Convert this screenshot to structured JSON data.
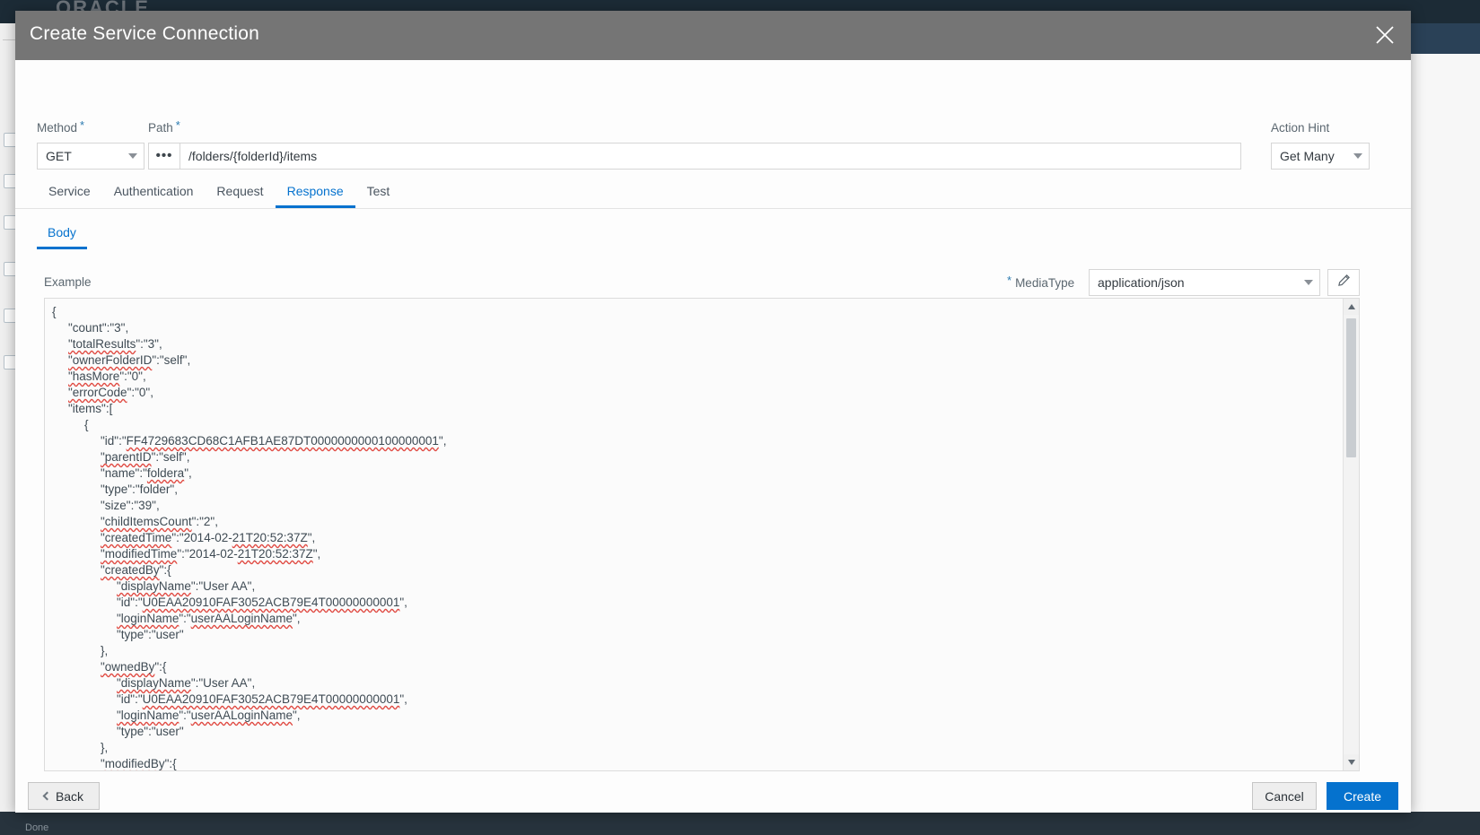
{
  "background": {
    "brand": "ORACLE",
    "status_text": "Done"
  },
  "dialog": {
    "title": "Create Service Connection",
    "close_icon": "close-icon"
  },
  "form": {
    "method": {
      "label": "Method",
      "required": true,
      "value": "GET"
    },
    "path": {
      "label": "Path",
      "required": true,
      "value": "/folders/{folderId}/items",
      "placeholder": "",
      "more_button": "•••"
    },
    "action_hint": {
      "label": "Action Hint",
      "required": false,
      "value": "Get Many"
    }
  },
  "tabs": [
    {
      "label": "Service",
      "active": false
    },
    {
      "label": "Authentication",
      "active": false
    },
    {
      "label": "Request",
      "active": false
    },
    {
      "label": "Response",
      "active": true
    },
    {
      "label": "Test",
      "active": false
    }
  ],
  "subtabs": [
    {
      "label": "Body",
      "active": true
    }
  ],
  "body_section": {
    "example_label": "Example",
    "mediatype_label": "MediaType",
    "mediatype_required": true,
    "mediatype_value": "application/json",
    "edit_icon": "pencil-icon"
  },
  "code": {
    "lines": [
      {
        "indent": 0,
        "text": "{"
      },
      {
        "indent": 1,
        "segments": [
          {
            "t": "\"count\":\"3\","
          }
        ]
      },
      {
        "indent": 1,
        "segments": [
          {
            "t": "\"totalResults",
            "sq": true
          },
          {
            "t": "\":\"3\","
          }
        ]
      },
      {
        "indent": 1,
        "segments": [
          {
            "t": "\"ownerFolderID",
            "sq": true
          },
          {
            "t": "\":\"self\","
          }
        ]
      },
      {
        "indent": 1,
        "segments": [
          {
            "t": "\"hasMore",
            "sq": true
          },
          {
            "t": "\":\"0\","
          }
        ]
      },
      {
        "indent": 1,
        "segments": [
          {
            "t": "\"errorCode",
            "sq": true
          },
          {
            "t": "\":\"0\","
          }
        ]
      },
      {
        "indent": 1,
        "segments": [
          {
            "t": "\"items\":["
          }
        ]
      },
      {
        "indent": 2,
        "segments": [
          {
            "t": "{"
          }
        ]
      },
      {
        "indent": 3,
        "segments": [
          {
            "t": "\"id\":\""
          },
          {
            "t": "FF4729683CD68C1AFB1AE87DT0000000000100000001",
            "sq": true
          },
          {
            "t": "\","
          }
        ]
      },
      {
        "indent": 3,
        "segments": [
          {
            "t": "\"parentID",
            "sq": true
          },
          {
            "t": "\":\"self\","
          }
        ]
      },
      {
        "indent": 3,
        "segments": [
          {
            "t": "\"name\":\""
          },
          {
            "t": "foldera",
            "sq": true
          },
          {
            "t": "\","
          }
        ]
      },
      {
        "indent": 3,
        "segments": [
          {
            "t": "\"type\":\"folder\","
          }
        ]
      },
      {
        "indent": 3,
        "segments": [
          {
            "t": "\"size\":\"39\","
          }
        ]
      },
      {
        "indent": 3,
        "segments": [
          {
            "t": "\"childItemsCount",
            "sq": true
          },
          {
            "t": "\":\"2\","
          }
        ]
      },
      {
        "indent": 3,
        "segments": [
          {
            "t": "\"createdTime",
            "sq": true
          },
          {
            "t": "\":\"2014-02-"
          },
          {
            "t": "21T20:52:37Z",
            "sq": true
          },
          {
            "t": "\","
          }
        ]
      },
      {
        "indent": 3,
        "segments": [
          {
            "t": "\"modifiedTime",
            "sq": true
          },
          {
            "t": "\":\"2014-02-"
          },
          {
            "t": "21T20:52:37Z",
            "sq": true
          },
          {
            "t": "\","
          }
        ]
      },
      {
        "indent": 3,
        "segments": [
          {
            "t": "\"createdBy",
            "sq": true
          },
          {
            "t": "\":{"
          }
        ]
      },
      {
        "indent": 4,
        "segments": [
          {
            "t": "\"displayName",
            "sq": true
          },
          {
            "t": "\":\"User AA\","
          }
        ]
      },
      {
        "indent": 4,
        "segments": [
          {
            "t": "\"id\":\""
          },
          {
            "t": "U0EAA20910FAF3052ACB79E4T00000000001",
            "sq": true
          },
          {
            "t": "\","
          }
        ]
      },
      {
        "indent": 4,
        "segments": [
          {
            "t": "\"loginName",
            "sq": true
          },
          {
            "t": "\":\""
          },
          {
            "t": "userAALoginName",
            "sq": true
          },
          {
            "t": "\","
          }
        ]
      },
      {
        "indent": 4,
        "segments": [
          {
            "t": "\"type\":\"user\""
          }
        ]
      },
      {
        "indent": 3,
        "segments": [
          {
            "t": "},"
          }
        ]
      },
      {
        "indent": 3,
        "segments": [
          {
            "t": "\"ownedBy",
            "sq": true
          },
          {
            "t": "\":{"
          }
        ]
      },
      {
        "indent": 4,
        "segments": [
          {
            "t": "\"displayName",
            "sq": true
          },
          {
            "t": "\":\"User AA\","
          }
        ]
      },
      {
        "indent": 4,
        "segments": [
          {
            "t": "\"id\":\""
          },
          {
            "t": "U0EAA20910FAF3052ACB79E4T00000000001",
            "sq": true
          },
          {
            "t": "\","
          }
        ]
      },
      {
        "indent": 4,
        "segments": [
          {
            "t": "\"loginName",
            "sq": true
          },
          {
            "t": "\":\""
          },
          {
            "t": "userAALoginName",
            "sq": true
          },
          {
            "t": "\","
          }
        ]
      },
      {
        "indent": 4,
        "segments": [
          {
            "t": "\"type\":\"user\""
          }
        ]
      },
      {
        "indent": 3,
        "segments": [
          {
            "t": "},"
          }
        ]
      },
      {
        "indent": 3,
        "segments": [
          {
            "t": "\"modifiedBy",
            "sq": true
          },
          {
            "t": "\":{"
          }
        ]
      }
    ]
  },
  "footer": {
    "back_label": "Back",
    "cancel_label": "Cancel",
    "create_label": "Create"
  },
  "colors": {
    "accent": "#0572ce",
    "titlebar": "#757575",
    "squiggle": "#e04a42",
    "text": "#3f4b54"
  }
}
